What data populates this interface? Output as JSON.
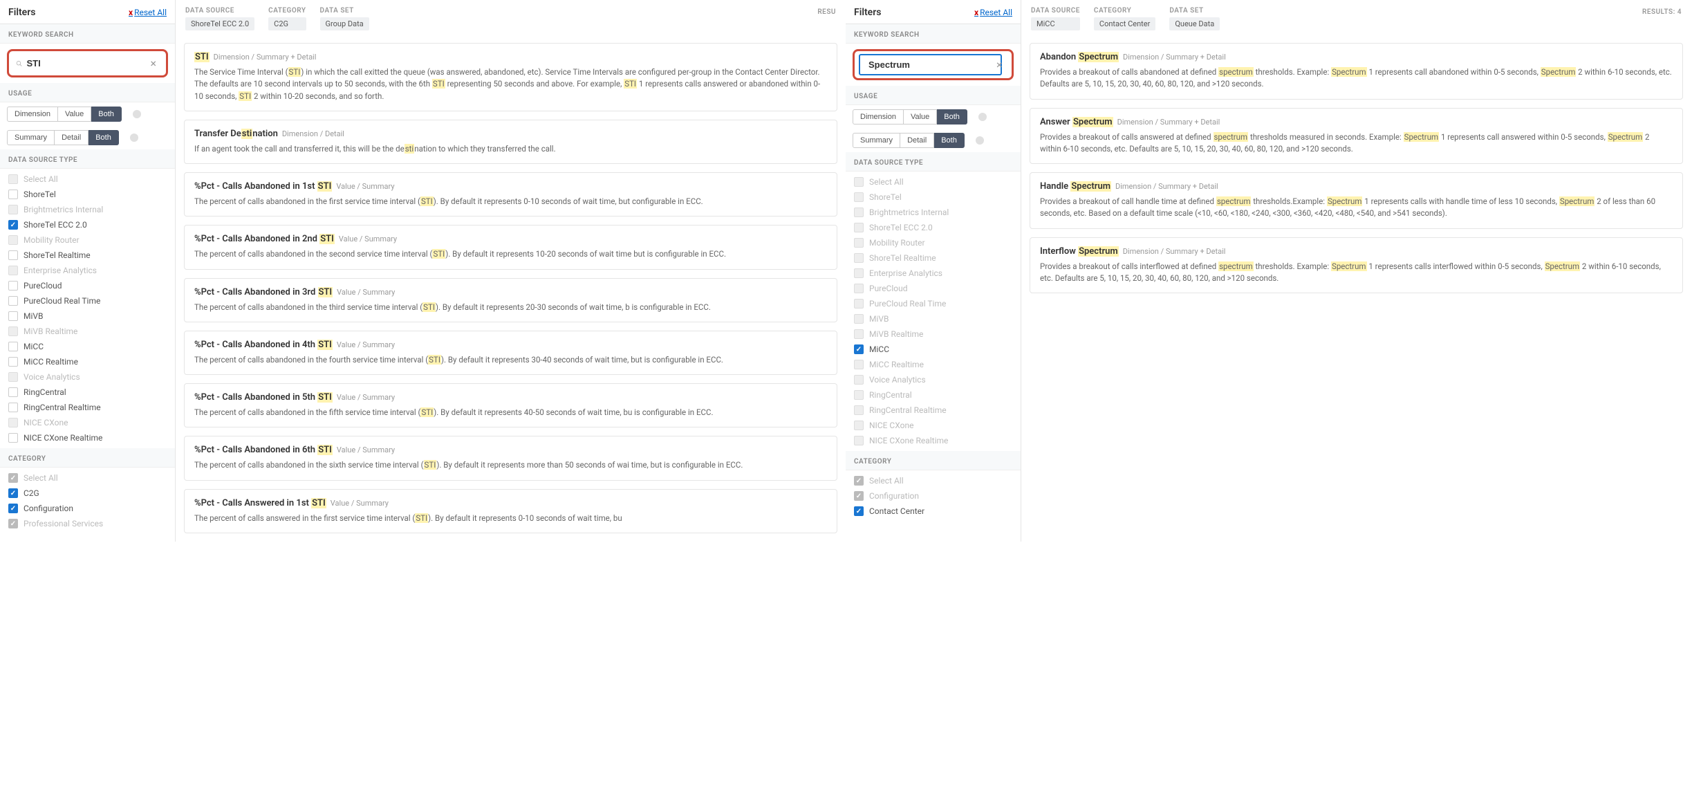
{
  "left": {
    "filters_title": "Filters",
    "reset_all": "Reset All",
    "reset_x": "x",
    "keyword_search_label": "KEYWORD SEARCH",
    "search_value": "STI",
    "usage_label": "USAGE",
    "usage_row1": [
      "Dimension",
      "Value",
      "Both"
    ],
    "usage_row2": [
      "Summary",
      "Detail",
      "Both"
    ],
    "data_source_type_label": "DATA SOURCE TYPE",
    "sources": [
      {
        "label": "Select All",
        "checked": false,
        "disabled": true
      },
      {
        "label": "ShoreTel",
        "checked": false,
        "disabled": false
      },
      {
        "label": "Brightmetrics Internal",
        "checked": false,
        "disabled": true
      },
      {
        "label": "ShoreTel ECC 2.0",
        "checked": true,
        "disabled": false
      },
      {
        "label": "Mobility Router",
        "checked": false,
        "disabled": true
      },
      {
        "label": "ShoreTel Realtime",
        "checked": false,
        "disabled": false
      },
      {
        "label": "Enterprise Analytics",
        "checked": false,
        "disabled": true
      },
      {
        "label": "PureCloud",
        "checked": false,
        "disabled": false
      },
      {
        "label": "PureCloud Real Time",
        "checked": false,
        "disabled": false
      },
      {
        "label": "MiVB",
        "checked": false,
        "disabled": false
      },
      {
        "label": "MiVB Realtime",
        "checked": false,
        "disabled": true
      },
      {
        "label": "MiCC",
        "checked": false,
        "disabled": false
      },
      {
        "label": "MiCC Realtime",
        "checked": false,
        "disabled": false
      },
      {
        "label": "Voice Analytics",
        "checked": false,
        "disabled": true
      },
      {
        "label": "RingCentral",
        "checked": false,
        "disabled": false
      },
      {
        "label": "RingCentral Realtime",
        "checked": false,
        "disabled": false
      },
      {
        "label": "NICE CXone",
        "checked": false,
        "disabled": true
      },
      {
        "label": "NICE CXone Realtime",
        "checked": false,
        "disabled": false
      }
    ],
    "category_label": "CATEGORY",
    "categories": [
      {
        "label": "Select All",
        "checked": true,
        "disabled": true
      },
      {
        "label": "C2G",
        "checked": true,
        "disabled": false
      },
      {
        "label": "Configuration",
        "checked": true,
        "disabled": false
      },
      {
        "label": "Professional Services",
        "checked": true,
        "disabled": true
      }
    ],
    "header": {
      "data_source_label": "DATA SOURCE",
      "data_source": "ShoreTel ECC 2.0",
      "category_label": "CATEGORY",
      "category": "C2G",
      "data_set_label": "DATA SET",
      "data_set": "Group Data",
      "results_label": "RESU"
    },
    "results": [
      {
        "title": "STI",
        "title_hl": "STI",
        "meta": "Dimension / Summary + Detail",
        "desc": "The Service Time Interval (STI) in which the call exitted the queue (was answered, abandoned, etc). Service Time Intervals are configured per-group in the Contact Center Director. The defaults are 10 second intervals up to 50 seconds, with the 6th STI representing 50 seconds and above. For example, STI 1 represents calls answered or abandoned within 0-10 seconds, STI 2 within 10-20 seconds, and so forth.",
        "hl": [
          "STI",
          "STI",
          "STI",
          "STI"
        ]
      },
      {
        "title": "Transfer Destination",
        "title_hl": "sti",
        "meta": "Dimension / Detail",
        "desc": "If an agent took the call and transferred it, this will be the destination to which they transferred the call.",
        "hl": [
          "sti"
        ]
      },
      {
        "title": "%Pct - Calls Abandoned in 1st STI",
        "title_hl": "STI",
        "meta": "Value / Summary",
        "desc": "The percent of calls abandoned in the first service time interval (STI). By default it represents 0-10 seconds of wait time, but configurable in ECC.",
        "hl": [
          "STI"
        ]
      },
      {
        "title": "%Pct - Calls Abandoned in 2nd STI",
        "title_hl": "STI",
        "meta": "Value / Summary",
        "desc": "The percent of calls abandoned in the second service time interval (STI). By default it represents 10-20 seconds of wait time but is configurable in ECC.",
        "hl": [
          "STI"
        ]
      },
      {
        "title": "%Pct - Calls Abandoned in 3rd STI",
        "title_hl": "STI",
        "meta": "Value / Summary",
        "desc": "The percent of calls abandoned in the third service time interval (STI). By default it represents 20-30 seconds of wait time, b is configurable in ECC.",
        "hl": [
          "STI"
        ]
      },
      {
        "title": "%Pct - Calls Abandoned in 4th STI",
        "title_hl": "STI",
        "meta": "Value / Summary",
        "desc": "The percent of calls abandoned in the fourth service time interval (STI). By default it represents 30-40 seconds of wait time, but is configurable in ECC.",
        "hl": [
          "STI"
        ]
      },
      {
        "title": "%Pct - Calls Abandoned in 5th STI",
        "title_hl": "STI",
        "meta": "Value / Summary",
        "desc": "The percent of calls abandoned in the fifth service time interval (STI). By default it represents 40-50 seconds of wait time, bu is configurable in ECC.",
        "hl": [
          "STI"
        ]
      },
      {
        "title": "%Pct - Calls Abandoned in 6th STI",
        "title_hl": "STI",
        "meta": "Value / Summary",
        "desc": "The percent of calls abandoned in the sixth service time interval (STI). By default it represents more than 50 seconds of wai time, but is configurable in ECC.",
        "hl": [
          "STI"
        ]
      },
      {
        "title": "%Pct - Calls Answered in 1st STI",
        "title_hl": "STI",
        "meta": "Value / Summary",
        "desc": "The percent of calls answered in the first service time interval (STI). By default it represents 0-10 seconds of wait time, bu",
        "hl": [
          "STI"
        ]
      }
    ]
  },
  "right": {
    "filters_title": "Filters",
    "reset_all": "Reset All",
    "reset_x": "x",
    "keyword_search_label": "KEYWORD SEARCH",
    "search_value": "Spectrum",
    "usage_label": "USAGE",
    "usage_row1": [
      "Dimension",
      "Value",
      "Both"
    ],
    "usage_row2": [
      "Summary",
      "Detail",
      "Both"
    ],
    "data_source_type_label": "DATA SOURCE TYPE",
    "sources": [
      {
        "label": "Select All",
        "checked": false,
        "disabled": true
      },
      {
        "label": "ShoreTel",
        "checked": false,
        "disabled": true
      },
      {
        "label": "Brightmetrics Internal",
        "checked": false,
        "disabled": true
      },
      {
        "label": "ShoreTel ECC 2.0",
        "checked": false,
        "disabled": true
      },
      {
        "label": "Mobility Router",
        "checked": false,
        "disabled": true
      },
      {
        "label": "ShoreTel Realtime",
        "checked": false,
        "disabled": true
      },
      {
        "label": "Enterprise Analytics",
        "checked": false,
        "disabled": true
      },
      {
        "label": "PureCloud",
        "checked": false,
        "disabled": true
      },
      {
        "label": "PureCloud Real Time",
        "checked": false,
        "disabled": true
      },
      {
        "label": "MiVB",
        "checked": false,
        "disabled": true
      },
      {
        "label": "MiVB Realtime",
        "checked": false,
        "disabled": true
      },
      {
        "label": "MiCC",
        "checked": true,
        "disabled": false
      },
      {
        "label": "MiCC Realtime",
        "checked": false,
        "disabled": true
      },
      {
        "label": "Voice Analytics",
        "checked": false,
        "disabled": true
      },
      {
        "label": "RingCentral",
        "checked": false,
        "disabled": true
      },
      {
        "label": "RingCentral Realtime",
        "checked": false,
        "disabled": true
      },
      {
        "label": "NICE CXone",
        "checked": false,
        "disabled": true
      },
      {
        "label": "NICE CXone Realtime",
        "checked": false,
        "disabled": true
      }
    ],
    "category_label": "CATEGORY",
    "categories": [
      {
        "label": "Select All",
        "checked": true,
        "disabled": true
      },
      {
        "label": "Configuration",
        "checked": true,
        "disabled": true
      },
      {
        "label": "Contact Center",
        "checked": true,
        "disabled": false
      }
    ],
    "header": {
      "data_source_label": "DATA SOURCE",
      "data_source": "MiCC",
      "category_label": "CATEGORY",
      "category": "Contact Center",
      "data_set_label": "DATA SET",
      "data_set": "Queue Data",
      "results_label": "RESULTS: 4"
    },
    "results": [
      {
        "title": "Abandon Spectrum",
        "title_hl": "Spectrum",
        "meta": "Dimension / Summary + Detail",
        "desc": "Provides a breakout of calls abandoned at defined spectrum thresholds. Example: Spectrum 1 represents call abandoned within 0-5 seconds, Spectrum 2 within 6-10 seconds, etc. Defaults are 5, 10, 15, 20, 30, 40, 60, 80, 120, and >120 seconds.",
        "hl": [
          "spectrum",
          "Spectrum",
          "Spectrum"
        ]
      },
      {
        "title": "Answer Spectrum",
        "title_hl": "Spectrum",
        "meta": "Dimension / Summary + Detail",
        "desc": "Provides a breakout of calls answered at defined spectrum thresholds measured in seconds. Example: Spectrum 1 represents call answered within 0-5 seconds, Spectrum 2 within 6-10 seconds, etc. Defaults are 5, 10, 15, 20, 30, 40, 60, 80, 120, and >120 seconds.",
        "hl": [
          "spectrum",
          "Spectrum",
          "Spectrum"
        ]
      },
      {
        "title": "Handle Spectrum",
        "title_hl": "Spectrum",
        "meta": "Dimension / Summary + Detail",
        "desc": "Provides a breakout of call handle time at defined spectrum thresholds.Example: Spectrum 1 represents calls with handle time of less 10 seconds, Spectrum 2 of less than 60 seconds, etc. Based on a default time scale (<10, <60, <180, <240, <300, <360, <420, <480, <540, and >541 seconds).",
        "hl": [
          "spectrum",
          "Spectrum",
          "Spectrum"
        ]
      },
      {
        "title": "Interflow Spectrum",
        "title_hl": "Spectrum",
        "meta": "Dimension / Summary + Detail",
        "desc": "Provides a breakout of calls interflowed at defined spectrum thresholds. Example: Spectrum 1 represents calls interflowed within 0-5 seconds, Spectrum 2 within 6-10 seconds, etc. Defaults are 5, 10, 15, 20, 30, 40, 60, 80, 120, and >120 seconds.",
        "hl": [
          "spectrum",
          "Spectrum",
          "Spectrum"
        ]
      }
    ]
  }
}
